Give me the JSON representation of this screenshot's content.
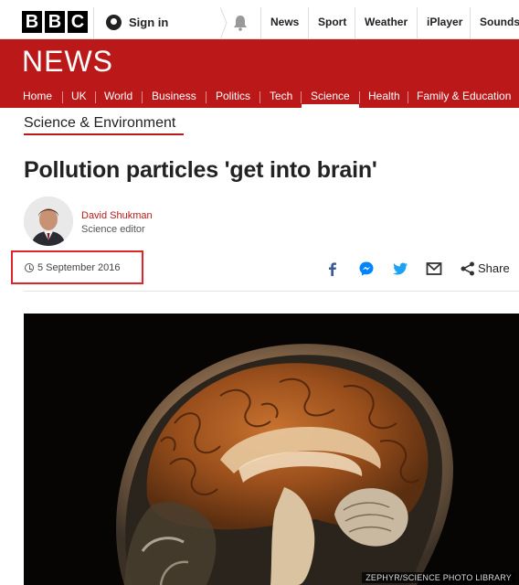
{
  "brand": {
    "logo_letters": [
      "B",
      "B",
      "C"
    ],
    "signin_label": "Sign in"
  },
  "top_nav": [
    "News",
    "Sport",
    "Weather",
    "iPlayer",
    "Sounds"
  ],
  "news_header": {
    "title": "NEWS"
  },
  "section_nav": [
    "Home",
    "UK",
    "World",
    "Business",
    "Politics",
    "Tech",
    "Science",
    "Health",
    "Family & Education"
  ],
  "section_nav_active": "Science",
  "article": {
    "section": "Science & Environment",
    "headline": "Pollution particles 'get into brain'",
    "author_name": "David Shukman",
    "author_role": "Science editor",
    "date": "5 September 2016",
    "share_label": "Share",
    "image_credit": "ZEPHYR/SCIENCE PHOTO LIBRARY"
  },
  "share_icons": [
    "facebook-icon",
    "messenger-icon",
    "twitter-icon",
    "email-icon",
    "share-icon"
  ],
  "colors": {
    "bbc_red": "#bb1919",
    "highlight_box": "#e0252a",
    "facebook": "#3b5998",
    "messenger": "#0084ff",
    "twitter": "#1da1f2"
  }
}
